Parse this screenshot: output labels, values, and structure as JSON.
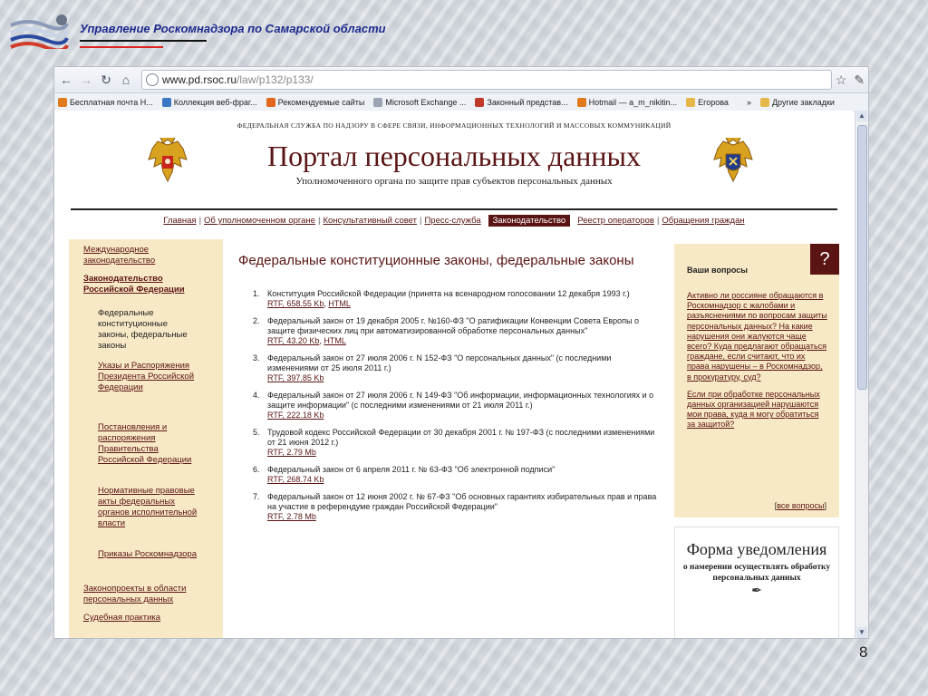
{
  "slide": {
    "title": "Управление Роскомнадзора по Самарской области",
    "page_number": "8"
  },
  "browser": {
    "url_host": "www.pd.rsoc.ru",
    "url_path": "/law/p132/p133/",
    "bookmarks": [
      {
        "label": "Бесплатная почта Н...",
        "icon_color": "#e07a1c"
      },
      {
        "label": "Коллекция веб-фраг...",
        "icon_color": "#3b78c4"
      },
      {
        "label": "Рекомендуемые сайты",
        "icon_color": "#e2661b"
      },
      {
        "label": "Microsoft Exchange ...",
        "icon_color": "#9aa4b4"
      },
      {
        "label": "Законный представ...",
        "icon_color": "#c0392b"
      },
      {
        "label": "Hotmail — a_m_nikitin...",
        "icon_color": "#e07a1c"
      },
      {
        "label": "Егорова",
        "icon_color": "#e6b84a"
      }
    ],
    "bookmarks_more": "»",
    "other_bookmarks": "Другие закладки"
  },
  "site": {
    "agency": "ФЕДЕРАЛЬНАЯ СЛУЖБА ПО НАДЗОРУ В СФЕРЕ СВЯЗИ, ИНФОРМАЦИОННЫХ ТЕХНОЛОГИЙ И МАССОВЫХ КОММУНИКАЦИЙ",
    "title": "Портал персональных данных",
    "subtitle": "Уполномоченного органа по защите прав субъектов персональных данных",
    "nav": [
      {
        "label": "Главная",
        "active": false
      },
      {
        "label": "Об уполномоченном органе",
        "active": false
      },
      {
        "label": "Консультативный совет",
        "active": false
      },
      {
        "label": "Пресс-служба",
        "active": false
      },
      {
        "label": "Законодательство",
        "active": true
      },
      {
        "label": "Реестр операторов",
        "active": false
      },
      {
        "label": "Обращения граждан",
        "active": false
      }
    ]
  },
  "left_menu": [
    {
      "label": "Международное законодательство",
      "level": 0,
      "bold": false,
      "link": true
    },
    {
      "label": "Законодательство Российской Федерации",
      "level": 0,
      "bold": true,
      "link": true
    },
    {
      "label": "Федеральные конституционные законы, федеральные законы",
      "level": 1,
      "bold": false,
      "link": false
    },
    {
      "label": "Указы и Распоряжения Президента Российской Федерации",
      "level": 1,
      "bold": false,
      "link": true
    },
    {
      "label": "Постановления и распоряжения Правительства Российской Федерации",
      "level": 1,
      "bold": false,
      "link": true
    },
    {
      "label": "Нормативные правовые акты федеральных органов исполнительной власти",
      "level": 1,
      "bold": false,
      "link": true
    },
    {
      "label": "Приказы Роскомнадзора",
      "level": 1,
      "bold": false,
      "link": true
    },
    {
      "label": "Законопроекты в области персональных данных",
      "level": 0,
      "bold": false,
      "link": true
    },
    {
      "label": "Судебная практика",
      "level": 0,
      "bold": false,
      "link": true
    }
  ],
  "main": {
    "heading": "Федеральные конституционные законы, федеральные законы",
    "laws": [
      {
        "num": "1.",
        "text": "Конституция Российской Федерации (принята на всенародном голосовании 12 декабря 1993 г.)",
        "links": [
          "RTF, 658.55 Kb",
          "HTML"
        ]
      },
      {
        "num": "2.",
        "text": "Федеральный закон от 19 декабря 2005 г. №160-ФЗ \"О ратификации Конвенции Совета Европы о защите физических лиц при автоматизированной обработке персональных данных\"",
        "links": [
          "RTF, 43.20 Kb",
          "HTML"
        ]
      },
      {
        "num": "3.",
        "text": "Федеральный закон от 27 июля 2006 г. N 152-ФЗ \"О персональных данных\" (с последними изменениями от 25 июля 2011 г.)",
        "links": [
          "RTF, 397.85 Kb"
        ]
      },
      {
        "num": "4.",
        "text": "Федеральный закон от 27 июля 2006 г. N 149-ФЗ \"Об информации, информационных технологиях и о защите информации\" (с последними изменениями от 21 июля 2011 г.)",
        "links": [
          "RTF, 222.18 Kb"
        ]
      },
      {
        "num": "5.",
        "text": "Трудовой кодекс Российской Федерации от 30 декабря 2001 г. № 197-ФЗ (с последними изменениями от 21 июня 2012 г.)",
        "links": [
          "RTF, 2.79 Mb"
        ]
      },
      {
        "num": "6.",
        "text": "Федеральный закон от 6 апреля 2011 г. № 63-ФЗ \"Об электронной подписи\"",
        "links": [
          "RTF, 268.74 Kb"
        ]
      },
      {
        "num": "7.",
        "text": "Федеральный закон от 12 июня 2002 г. № 67-ФЗ \"Об основных гарантиях избирательных прав и права на участие в референдуме граждан Российской Федерации\"",
        "links": [
          "RTF, 2.78 Mb"
        ]
      }
    ]
  },
  "questions": {
    "badge": "?",
    "title": "Ваши вопросы",
    "items": [
      "Активно ли россияне обращаются в Роскомнадзор с жалобами и разъяснениями по вопросам защиты персональных данных? На какие нарушения они жалуются чаще всего? Куда предлагают обращаться граждане, если считают, что их права нарушены – в Роскомнадзор, в прокуратуру, суд?",
      "Если при обработке персональных данных организацией нарушаются мои права, куда я могу обратиться за защитой?"
    ],
    "all_label": "все вопросы"
  },
  "notice_form": {
    "title": "Форма уведомления",
    "subtitle": "о намерении осуществлять обработку персональных данных"
  },
  "colors": {
    "brand": "#5a1414",
    "panel": "#f8e9c6",
    "slide_title": "#1d2a8e"
  }
}
